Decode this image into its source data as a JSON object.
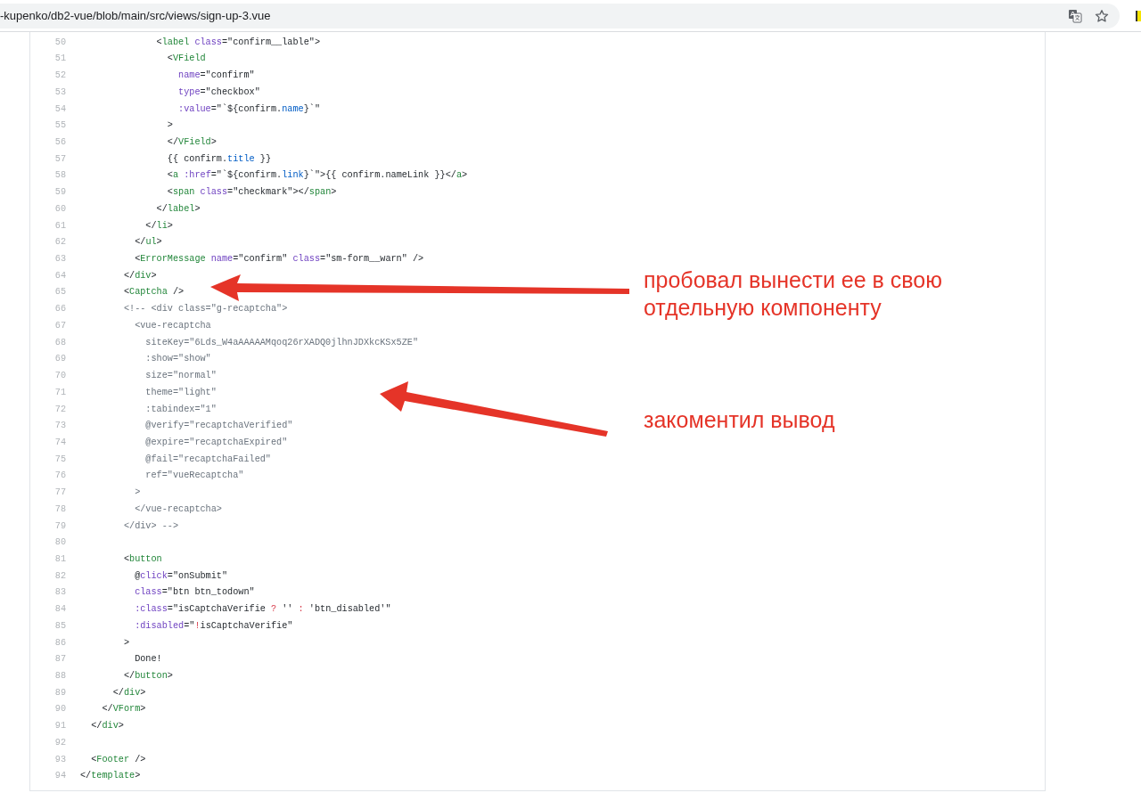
{
  "address_bar": {
    "url": "-kupenko/db2-vue/blob/main/src/views/sign-up-3.vue"
  },
  "code": {
    "lines": [
      {
        "number": "50",
        "segments": [
          {
            "kind": "plain",
            "text": "              <"
          },
          {
            "kind": "tag",
            "text": "label"
          },
          {
            "kind": "attr",
            "text": " class"
          },
          {
            "kind": "plain",
            "text": "=\"confirm__lable\">"
          }
        ]
      },
      {
        "number": "51",
        "segments": [
          {
            "kind": "plain",
            "text": "                <"
          },
          {
            "kind": "tag",
            "text": "VField"
          }
        ]
      },
      {
        "number": "52",
        "segments": [
          {
            "kind": "attr",
            "text": "                  name"
          },
          {
            "kind": "plain",
            "text": "=\"confirm\""
          }
        ]
      },
      {
        "number": "53",
        "segments": [
          {
            "kind": "attr",
            "text": "                  type"
          },
          {
            "kind": "plain",
            "text": "=\"checkbox\""
          }
        ]
      },
      {
        "number": "54",
        "segments": [
          {
            "kind": "attr",
            "text": "                  :value"
          },
          {
            "kind": "plain",
            "text": "=\"`${confirm."
          },
          {
            "kind": "prop",
            "text": "name"
          },
          {
            "kind": "plain",
            "text": "}`\""
          }
        ]
      },
      {
        "number": "55",
        "segments": [
          {
            "kind": "plain",
            "text": "                >"
          }
        ]
      },
      {
        "number": "56",
        "segments": [
          {
            "kind": "plain",
            "text": "                </"
          },
          {
            "kind": "tag",
            "text": "VField"
          },
          {
            "kind": "plain",
            "text": ">"
          }
        ]
      },
      {
        "number": "57",
        "segments": [
          {
            "kind": "plain",
            "text": "                {{ confirm."
          },
          {
            "kind": "prop",
            "text": "title"
          },
          {
            "kind": "plain",
            "text": " }}"
          }
        ]
      },
      {
        "number": "58",
        "segments": [
          {
            "kind": "plain",
            "text": "                <"
          },
          {
            "kind": "tag",
            "text": "a"
          },
          {
            "kind": "attr",
            "text": " :href"
          },
          {
            "kind": "plain",
            "text": "=\"`${confirm."
          },
          {
            "kind": "prop",
            "text": "link"
          },
          {
            "kind": "plain",
            "text": "}`\">{{ confirm.nameLink }}</"
          },
          {
            "kind": "tag",
            "text": "a"
          },
          {
            "kind": "plain",
            "text": ">"
          }
        ]
      },
      {
        "number": "59",
        "segments": [
          {
            "kind": "plain",
            "text": "                <"
          },
          {
            "kind": "tag",
            "text": "span"
          },
          {
            "kind": "attr",
            "text": " class"
          },
          {
            "kind": "plain",
            "text": "=\"checkmark\"></"
          },
          {
            "kind": "tag",
            "text": "span"
          },
          {
            "kind": "plain",
            "text": ">"
          }
        ]
      },
      {
        "number": "60",
        "segments": [
          {
            "kind": "plain",
            "text": "              </"
          },
          {
            "kind": "tag",
            "text": "label"
          },
          {
            "kind": "plain",
            "text": ">"
          }
        ]
      },
      {
        "number": "61",
        "segments": [
          {
            "kind": "plain",
            "text": "            </"
          },
          {
            "kind": "tag",
            "text": "li"
          },
          {
            "kind": "plain",
            "text": ">"
          }
        ]
      },
      {
        "number": "62",
        "segments": [
          {
            "kind": "plain",
            "text": "          </"
          },
          {
            "kind": "tag",
            "text": "ul"
          },
          {
            "kind": "plain",
            "text": ">"
          }
        ]
      },
      {
        "number": "63",
        "segments": [
          {
            "kind": "plain",
            "text": "          <"
          },
          {
            "kind": "tag",
            "text": "ErrorMessage"
          },
          {
            "kind": "attr",
            "text": " name"
          },
          {
            "kind": "plain",
            "text": "=\"confirm\" "
          },
          {
            "kind": "attr",
            "text": "class"
          },
          {
            "kind": "plain",
            "text": "=\"sm-form__warn\" />"
          }
        ]
      },
      {
        "number": "64",
        "segments": [
          {
            "kind": "plain",
            "text": "        </"
          },
          {
            "kind": "tag",
            "text": "div"
          },
          {
            "kind": "plain",
            "text": ">"
          }
        ]
      },
      {
        "number": "65",
        "segments": [
          {
            "kind": "plain",
            "text": "        <"
          },
          {
            "kind": "tag",
            "text": "Captcha"
          },
          {
            "kind": "plain",
            "text": " />"
          }
        ]
      },
      {
        "number": "66",
        "segments": [
          {
            "kind": "comment",
            "text": "        <!-- <div class=\"g-recaptcha\">"
          }
        ]
      },
      {
        "number": "67",
        "segments": [
          {
            "kind": "comment",
            "text": "          <vue-recaptcha"
          }
        ]
      },
      {
        "number": "68",
        "segments": [
          {
            "kind": "comment",
            "text": "            siteKey=\"6Lds_W4aAAAAAMqoq26rXADQ0jlhnJDXkcKSx5ZE\""
          }
        ]
      },
      {
        "number": "69",
        "segments": [
          {
            "kind": "comment",
            "text": "            :show=\"show\""
          }
        ]
      },
      {
        "number": "70",
        "segments": [
          {
            "kind": "comment",
            "text": "            size=\"normal\""
          }
        ]
      },
      {
        "number": "71",
        "segments": [
          {
            "kind": "comment",
            "text": "            theme=\"light\""
          }
        ]
      },
      {
        "number": "72",
        "segments": [
          {
            "kind": "comment",
            "text": "            :tabindex=\"1\""
          }
        ]
      },
      {
        "number": "73",
        "segments": [
          {
            "kind": "comment",
            "text": "            @verify=\"recaptchaVerified\""
          }
        ]
      },
      {
        "number": "74",
        "segments": [
          {
            "kind": "comment",
            "text": "            @expire=\"recaptchaExpired\""
          }
        ]
      },
      {
        "number": "75",
        "segments": [
          {
            "kind": "comment",
            "text": "            @fail=\"recaptchaFailed\""
          }
        ]
      },
      {
        "number": "76",
        "segments": [
          {
            "kind": "comment",
            "text": "            ref=\"vueRecaptcha\""
          }
        ]
      },
      {
        "number": "77",
        "segments": [
          {
            "kind": "comment",
            "text": "          >"
          }
        ]
      },
      {
        "number": "78",
        "segments": [
          {
            "kind": "comment",
            "text": "          </vue-recaptcha>"
          }
        ]
      },
      {
        "number": "79",
        "segments": [
          {
            "kind": "comment",
            "text": "        </div> -->"
          }
        ]
      },
      {
        "number": "80"
      },
      {
        "number": "81",
        "segments": [
          {
            "kind": "plain",
            "text": "        <"
          },
          {
            "kind": "tag",
            "text": "button"
          }
        ]
      },
      {
        "number": "82",
        "segments": [
          {
            "kind": "plain",
            "text": "          @"
          },
          {
            "kind": "attr",
            "text": "click"
          },
          {
            "kind": "plain",
            "text": "=\"onSubmit\""
          }
        ]
      },
      {
        "number": "83",
        "segments": [
          {
            "kind": "attr",
            "text": "          class"
          },
          {
            "kind": "plain",
            "text": "=\"btn btn_todown\""
          }
        ]
      },
      {
        "number": "84",
        "segments": [
          {
            "kind": "attr",
            "text": "          :class"
          },
          {
            "kind": "plain",
            "text": "=\"isCaptchaVerifie "
          },
          {
            "kind": "op",
            "text": "?"
          },
          {
            "kind": "plain",
            "text": " '' "
          },
          {
            "kind": "op",
            "text": ":"
          },
          {
            "kind": "plain",
            "text": " 'btn_disabled'\""
          }
        ]
      },
      {
        "number": "85",
        "segments": [
          {
            "kind": "attr",
            "text": "          :disabled"
          },
          {
            "kind": "plain",
            "text": "=\""
          },
          {
            "kind": "op",
            "text": "!"
          },
          {
            "kind": "plain",
            "text": "isCaptchaVerifie\""
          }
        ]
      },
      {
        "number": "86",
        "segments": [
          {
            "kind": "plain",
            "text": "        >"
          }
        ]
      },
      {
        "number": "87",
        "segments": [
          {
            "kind": "plain",
            "text": "          Done!"
          }
        ]
      },
      {
        "number": "88",
        "segments": [
          {
            "kind": "plain",
            "text": "        </"
          },
          {
            "kind": "tag",
            "text": "button"
          },
          {
            "kind": "plain",
            "text": ">"
          }
        ]
      },
      {
        "number": "89",
        "segments": [
          {
            "kind": "plain",
            "text": "      </"
          },
          {
            "kind": "tag",
            "text": "div"
          },
          {
            "kind": "plain",
            "text": ">"
          }
        ]
      },
      {
        "number": "90",
        "segments": [
          {
            "kind": "plain",
            "text": "    </"
          },
          {
            "kind": "tag",
            "text": "VForm"
          },
          {
            "kind": "plain",
            "text": ">"
          }
        ]
      },
      {
        "number": "91",
        "segments": [
          {
            "kind": "plain",
            "text": "  </"
          },
          {
            "kind": "tag",
            "text": "div"
          },
          {
            "kind": "plain",
            "text": ">"
          }
        ]
      },
      {
        "number": "92"
      },
      {
        "number": "93",
        "segments": [
          {
            "kind": "plain",
            "text": "  <"
          },
          {
            "kind": "tag",
            "text": "Footer"
          },
          {
            "kind": "plain",
            "text": " />"
          }
        ]
      },
      {
        "number": "94",
        "segments": [
          {
            "kind": "plain",
            "text": "</"
          },
          {
            "kind": "tag",
            "text": "template"
          },
          {
            "kind": "plain",
            "text": ">"
          }
        ]
      }
    ]
  },
  "annotations": [
    {
      "text": "пробовал вынести ее в свою отдельную компоненту"
    },
    {
      "text": "закоментил вывод"
    }
  ]
}
